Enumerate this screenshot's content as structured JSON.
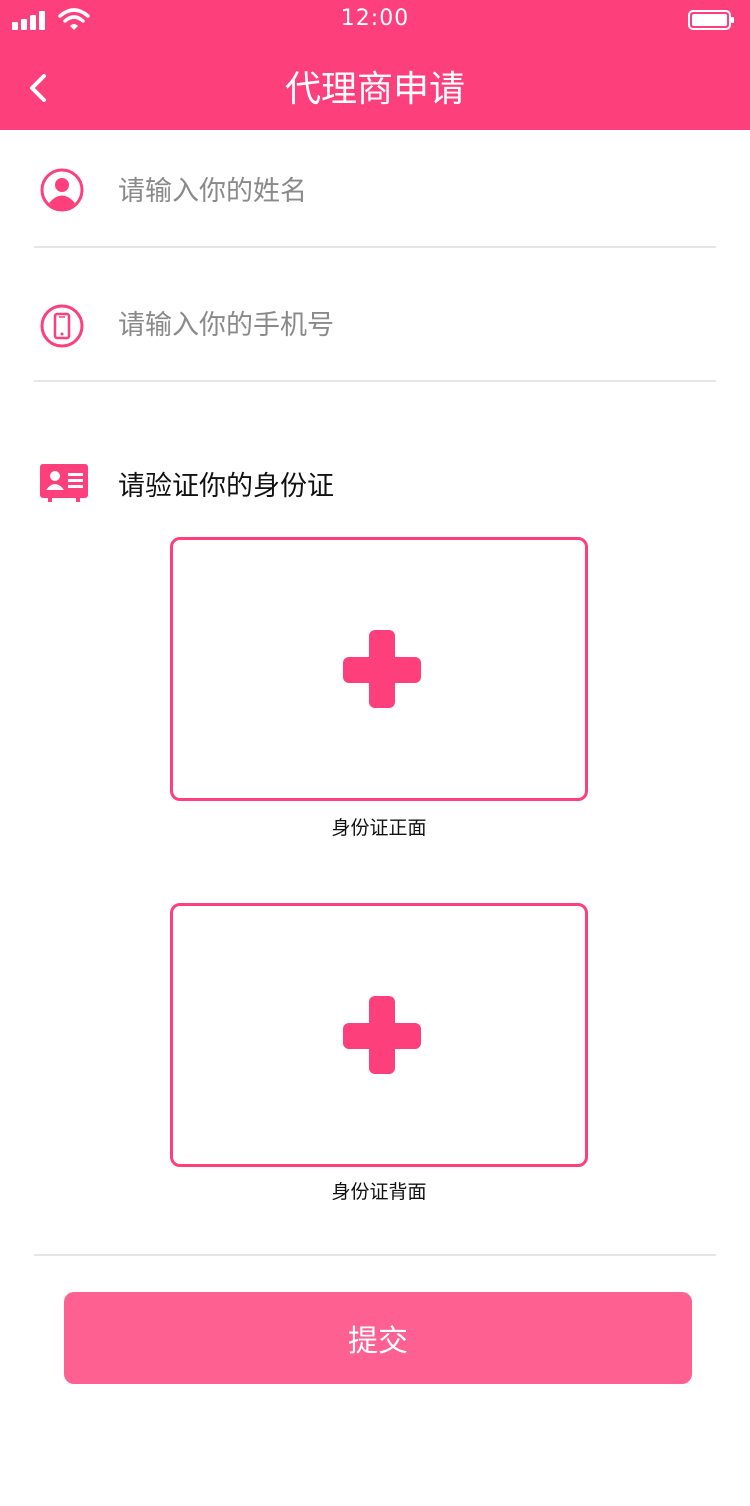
{
  "status_bar": {
    "time": "12:00"
  },
  "header": {
    "title": "代理商申请"
  },
  "form": {
    "name_placeholder": "请输入你的姓名",
    "phone_placeholder": "请输入你的手机号",
    "id_section_label": "请验证你的身份证",
    "front_caption": "身份证正面",
    "back_caption": "身份证背面",
    "submit_label": "提交"
  },
  "icons": {
    "back": "chevron-left-icon",
    "name": "user-icon",
    "phone": "phone-icon",
    "id_card": "id-card-icon",
    "upload": "plus-icon"
  },
  "colors": {
    "brand": "#fd3f7c",
    "button": "#fe6191",
    "divider": "#e6e6e6"
  }
}
